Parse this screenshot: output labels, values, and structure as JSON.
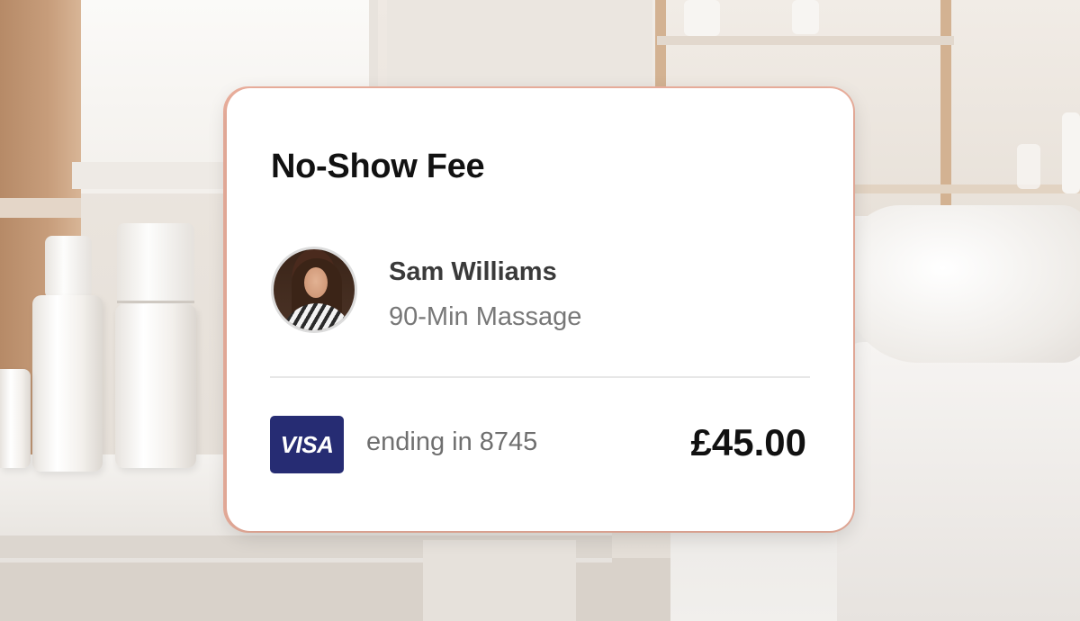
{
  "card": {
    "title": "No-Show Fee",
    "client": {
      "name": "Sam Williams",
      "service": "90-Min Massage",
      "avatar_icon": "client-photo"
    },
    "payment": {
      "brand": "VISA",
      "brand_color": "#262c73",
      "ending_text": "ending in 8745",
      "amount": "£45.00"
    },
    "accent_color": "#efb29f"
  }
}
